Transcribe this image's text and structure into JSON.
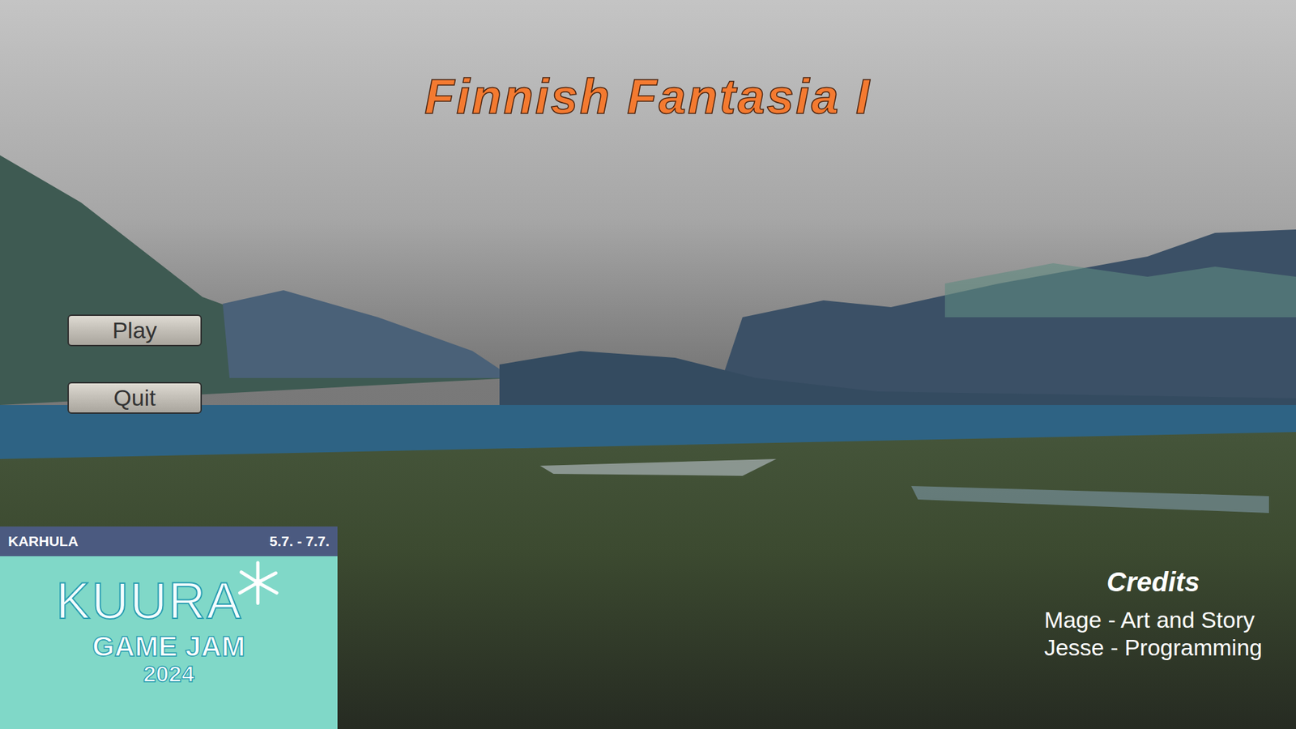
{
  "title": "Finnish Fantasia I",
  "menu": [
    {
      "label": "Play"
    },
    {
      "label": "Quit"
    }
  ],
  "badge": {
    "location": "KARHULA",
    "dates": "5.7. - 7.7.",
    "name": "KUURA",
    "event": "GAME JAM",
    "year": "2024"
  },
  "credits": {
    "heading": "Credits",
    "lines": [
      "Mage - Art and Story",
      "Jesse - Programming"
    ]
  }
}
